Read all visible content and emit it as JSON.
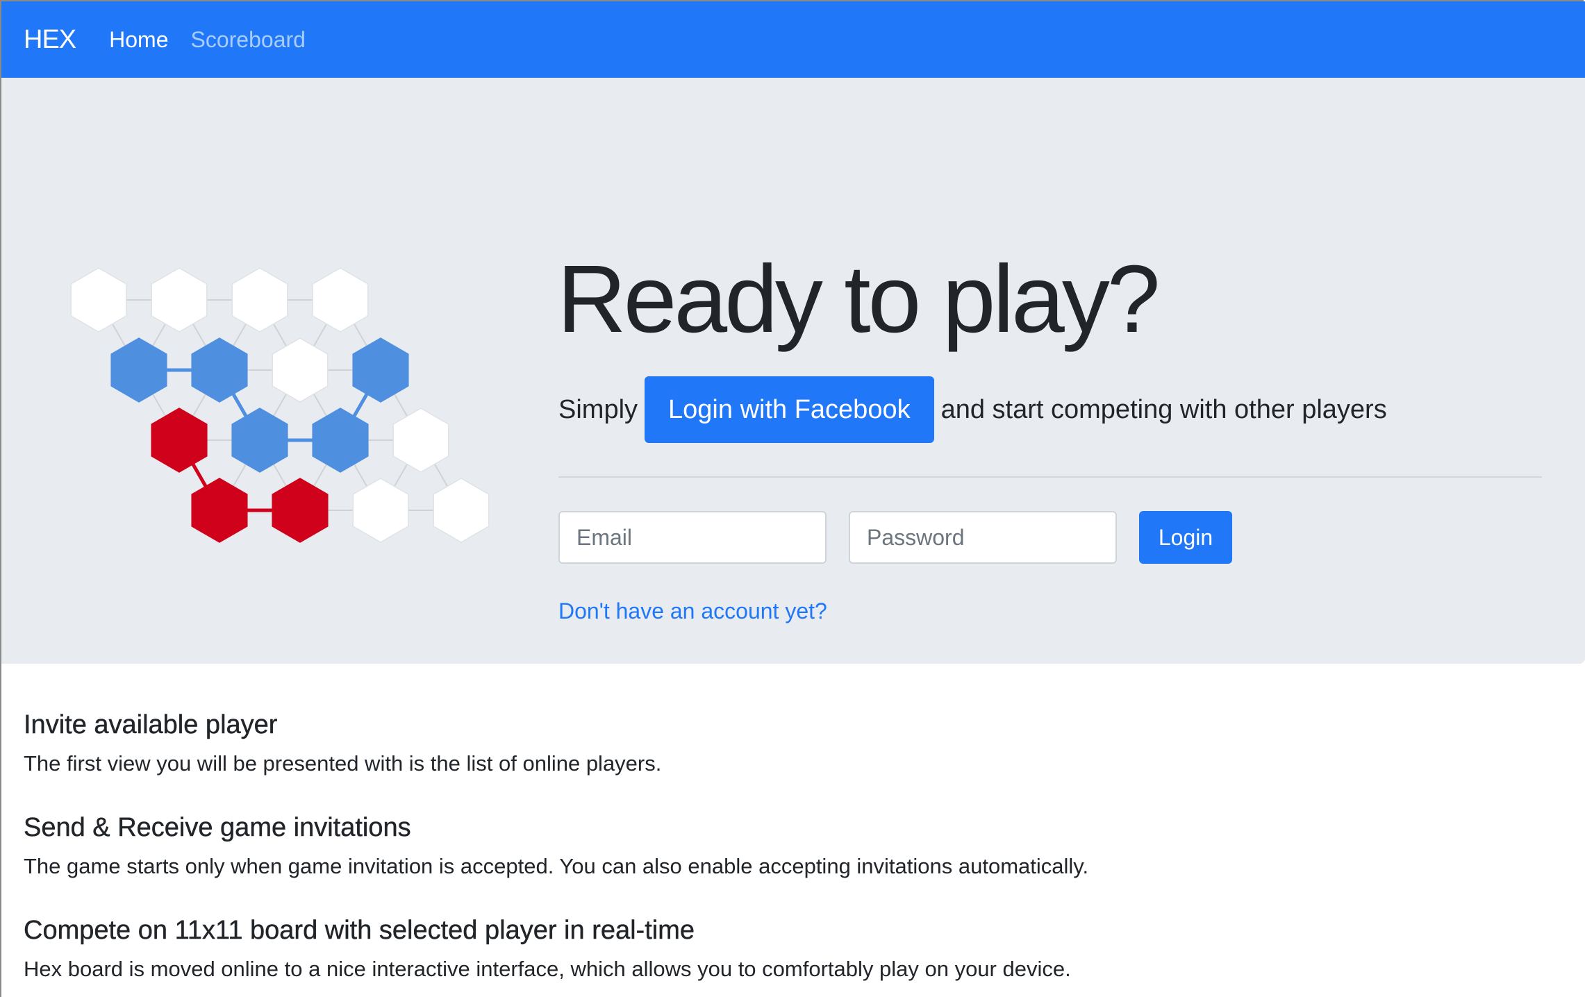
{
  "nav": {
    "brand": "HEX",
    "items": [
      {
        "label": "Home",
        "active": true
      },
      {
        "label": "Scoreboard",
        "active": false
      }
    ]
  },
  "hero": {
    "title": "Ready to play?",
    "lead_prefix": "Simply",
    "facebook_button": "Login with Facebook",
    "lead_suffix": "and start competing with other players"
  },
  "login_form": {
    "email_placeholder": "Email",
    "password_placeholder": "Password",
    "submit_label": "Login",
    "signup_link": "Don't have an account yet?"
  },
  "features": [
    {
      "title": "Invite available player",
      "text": "The first view you will be presented with is the list of online players."
    },
    {
      "title": "Send & Receive game invitations",
      "text": "The game starts only when game invitation is accepted. You can also enable accepting invitations automatically."
    },
    {
      "title": "Compete on 11x11 board with selected player in real-time",
      "text": "Hex board is moved online to a nice interactive interface, which allows you to comfortably play on your device."
    }
  ],
  "colors": {
    "primary": "#2078f8",
    "jumbotron_bg": "#e8ebef",
    "blue_stone": "#4f8fe0",
    "red_stone": "#d0021b",
    "empty_cell": "#ffffff"
  },
  "board_illustration": {
    "rows": [
      [
        "empty",
        "empty",
        "empty",
        "empty"
      ],
      [
        "blue",
        "blue",
        "empty",
        "blue"
      ],
      [
        "red",
        "blue",
        "blue",
        "empty"
      ],
      [
        "red",
        "red",
        "empty",
        "empty"
      ]
    ]
  }
}
